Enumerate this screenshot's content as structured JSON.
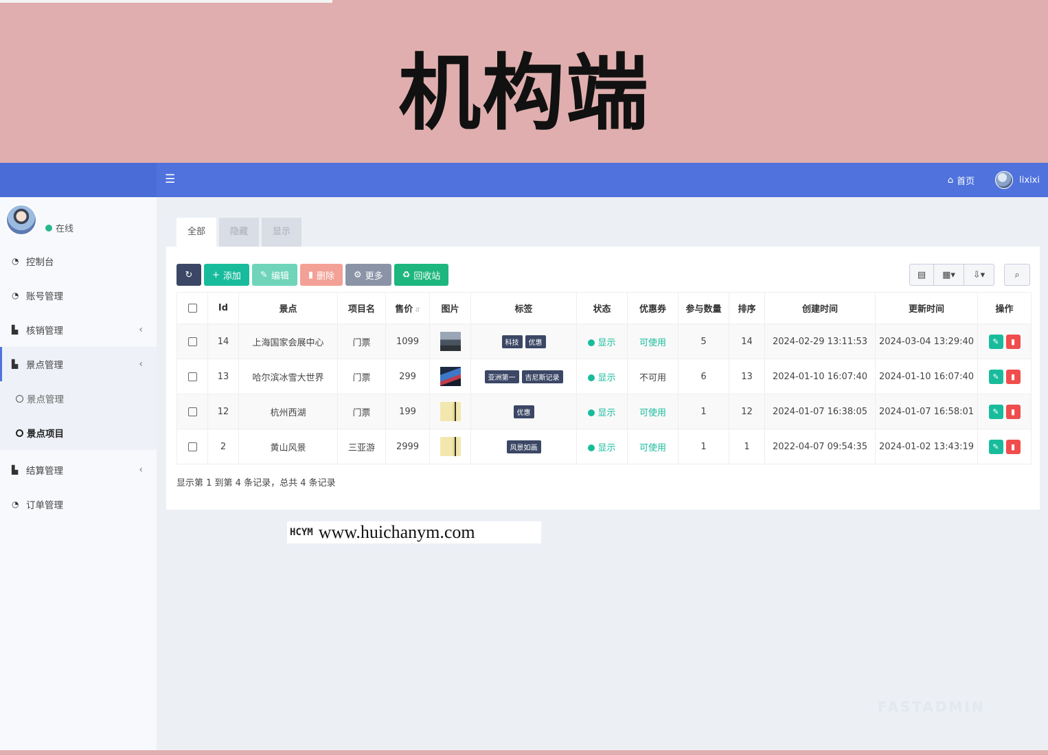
{
  "banner": {
    "title": "机构端"
  },
  "topbar": {
    "home_label": "首页",
    "user_name": "lixixi"
  },
  "sidebar": {
    "status": "在线",
    "items": [
      {
        "label": "控制台",
        "icon": "dashboard-icon"
      },
      {
        "label": "账号管理",
        "icon": "dashboard-icon"
      },
      {
        "label": "核销管理",
        "icon": "briefcase-icon"
      },
      {
        "label": "景点管理",
        "icon": "briefcase-icon"
      },
      {
        "label": "景点管理",
        "icon": "circle-icon"
      },
      {
        "label": "景点项目",
        "icon": "circle-icon"
      },
      {
        "label": "结算管理",
        "icon": "briefcase-icon"
      },
      {
        "label": "订单管理",
        "icon": "dashboard-icon"
      }
    ]
  },
  "tabs": [
    "全部",
    "隐藏",
    "显示"
  ],
  "toolbar": {
    "add": "添加",
    "edit": "编辑",
    "delete": "删除",
    "more": "更多",
    "recycle": "回收站"
  },
  "table": {
    "headers": [
      "Id",
      "景点",
      "项目名",
      "售价",
      "图片",
      "标签",
      "状态",
      "优惠券",
      "参与数量",
      "排序",
      "创建时间",
      "更新时间",
      "操作"
    ],
    "rows": [
      {
        "id": "14",
        "spot": "上海国家会展中心",
        "name": "门票",
        "price": "1099",
        "tags": [
          "科技",
          "优惠"
        ],
        "status": "显示",
        "coupon": "可使用",
        "coupon_ok": true,
        "count": "5",
        "sort": "14",
        "created": "2024-02-29 13:11:53",
        "updated": "2024-03-04 13:29:40"
      },
      {
        "id": "13",
        "spot": "哈尔滨冰雪大世界",
        "name": "门票",
        "price": "299",
        "tags": [
          "亚洲第一",
          "吉尼斯记录"
        ],
        "status": "显示",
        "coupon": "不可用",
        "coupon_ok": false,
        "count": "6",
        "sort": "13",
        "created": "2024-01-10 16:07:40",
        "updated": "2024-01-10 16:07:40"
      },
      {
        "id": "12",
        "spot": "杭州西湖",
        "name": "门票",
        "price": "199",
        "tags": [
          "优惠"
        ],
        "status": "显示",
        "coupon": "可使用",
        "coupon_ok": true,
        "count": "1",
        "sort": "12",
        "created": "2024-01-07 16:38:05",
        "updated": "2024-01-07 16:58:01"
      },
      {
        "id": "2",
        "spot": "黄山风景",
        "name": "三亚游",
        "price": "2999",
        "tags": [
          "风景如画"
        ],
        "status": "显示",
        "coupon": "可使用",
        "coupon_ok": true,
        "count": "1",
        "sort": "1",
        "created": "2022-04-07 09:54:35",
        "updated": "2024-01-02 13:43:19"
      }
    ]
  },
  "footer": {
    "info": "显示第 1 到第 4 条记录，总共 4 条记录"
  },
  "watermark": {
    "logo": "HCYM",
    "url": "www.huichanym.com"
  },
  "brand_mark": "FASTADMIN"
}
